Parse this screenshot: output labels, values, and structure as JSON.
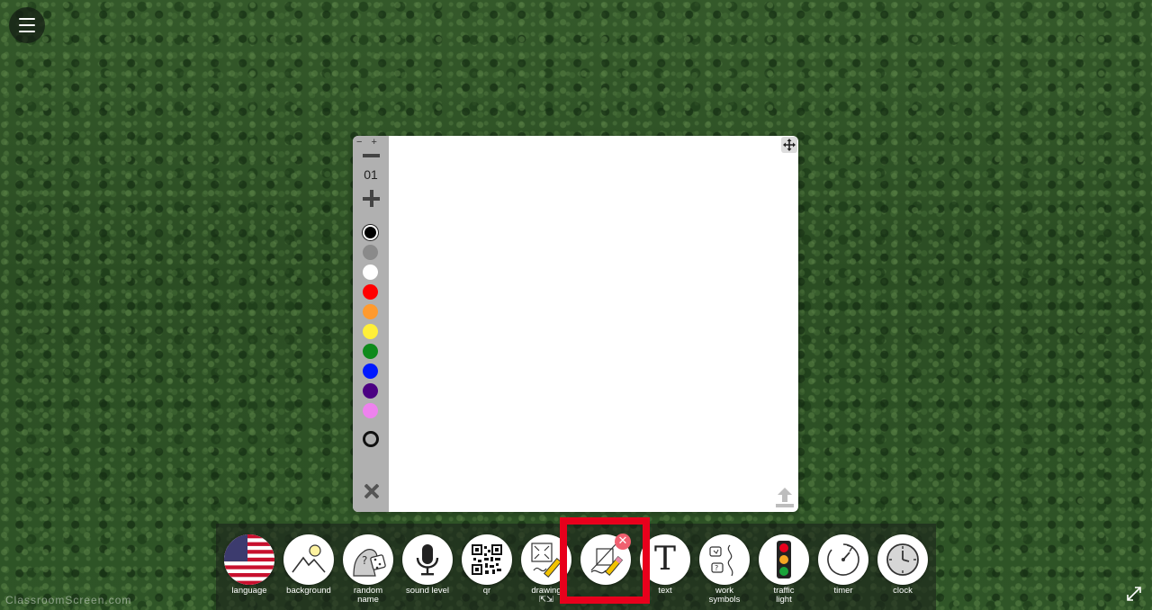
{
  "drawing": {
    "size_value": "01",
    "zoom_out": "−",
    "zoom_in": "+",
    "colors": [
      {
        "name": "black",
        "hex": "#000000",
        "selected": true
      },
      {
        "name": "gray",
        "hex": "#8a8a8a"
      },
      {
        "name": "white",
        "hex": "#ffffff"
      },
      {
        "name": "red",
        "hex": "#ff0000"
      },
      {
        "name": "orange",
        "hex": "#ff9a2e"
      },
      {
        "name": "yellow",
        "hex": "#ffef3a"
      },
      {
        "name": "green",
        "hex": "#0f8a1c"
      },
      {
        "name": "blue",
        "hex": "#0019ff"
      },
      {
        "name": "purple",
        "hex": "#4b0082"
      },
      {
        "name": "pink",
        "hex": "#ee82ee"
      }
    ],
    "icons": {
      "move": "move-arrows-icon",
      "upload": "upload-icon",
      "clear": "close-icon",
      "eraser": "eraser-ring-icon"
    }
  },
  "toolbar": {
    "items": [
      {
        "id": "language",
        "label": "language",
        "icon": "us-flag-icon"
      },
      {
        "id": "background",
        "label": "background",
        "icon": "landscape-icon"
      },
      {
        "id": "random-name",
        "label": "random\nname",
        "icon": "random-name-icon"
      },
      {
        "id": "sound-level",
        "label": "sound level",
        "icon": "microphone-icon"
      },
      {
        "id": "qr",
        "label": "qr",
        "icon": "qr-code-icon"
      },
      {
        "id": "drawing",
        "label": "drawing",
        "icon": "drawing-expand-icon"
      },
      {
        "id": "draw",
        "label": "",
        "icon": "draw-pencil-icon",
        "highlighted": true
      },
      {
        "id": "text",
        "label": "text",
        "icon": "text-icon"
      },
      {
        "id": "work-symbols",
        "label": "work\nsymbols",
        "icon": "work-symbols-icon"
      },
      {
        "id": "traffic-light",
        "label": "traffic\nlight",
        "icon": "traffic-light-icon"
      },
      {
        "id": "timer",
        "label": "timer",
        "icon": "timer-icon"
      },
      {
        "id": "clock",
        "label": "clock",
        "icon": "clock-icon"
      }
    ],
    "remove_badge": "✕",
    "drawing_resize_glyph": "⇱⇲"
  },
  "footer": {
    "watermark": "ClassroomScreen.com"
  },
  "colors": {
    "highlight": "#e8001c",
    "toolbar_gray": "#b0b0b0"
  }
}
